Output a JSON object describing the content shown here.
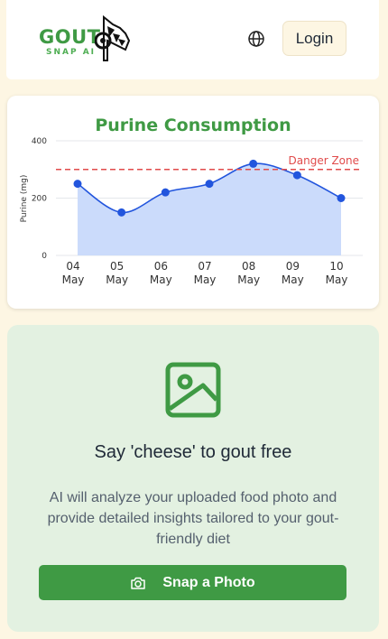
{
  "header": {
    "logo_text": "GOUT",
    "logo_subtext": "SNAP AI",
    "language_icon": "globe-icon",
    "login_label": "Login"
  },
  "chart_data": {
    "type": "area",
    "title": "Purine Consumption",
    "ylabel": "Purine (mg)",
    "xlabel": "",
    "categories": [
      [
        "04",
        "May"
      ],
      [
        "05",
        "May"
      ],
      [
        "06",
        "May"
      ],
      [
        "07",
        "May"
      ],
      [
        "08",
        "May"
      ],
      [
        "09",
        "May"
      ],
      [
        "10",
        "May"
      ]
    ],
    "values": [
      250,
      150,
      220,
      250,
      320,
      280,
      200
    ],
    "ylim": [
      0,
      400
    ],
    "yticks": [
      0,
      200,
      400
    ],
    "threshold": {
      "value": 300,
      "label": "Danger Zone",
      "color": "#e14b4b"
    },
    "colors": {
      "title": "#3f9a44",
      "line": "#2255dd",
      "fill": "#cbdbfb",
      "point": "#2255dd"
    },
    "grid": true
  },
  "upload": {
    "icon": "image-icon",
    "title": "Say 'cheese' to gout free",
    "description": "AI will analyze your uploaded food photo and provide detailed insights tailored to your gout-friendly diet",
    "button_icon": "camera-icon",
    "button_label": "Snap a Photo"
  },
  "colors": {
    "page_bg": "#fdf6e3",
    "brand_green": "#3f9a44",
    "upload_bg": "#e3f1e1"
  }
}
